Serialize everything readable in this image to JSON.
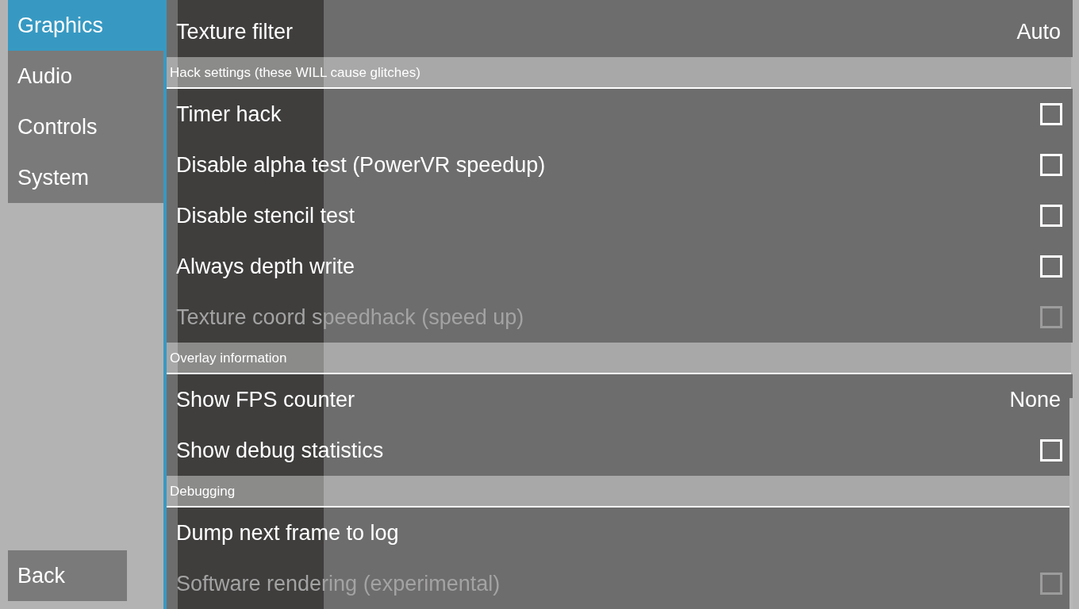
{
  "sidebar": {
    "tabs": [
      {
        "label": "Graphics",
        "selected": true
      },
      {
        "label": "Audio",
        "selected": false
      },
      {
        "label": "Controls",
        "selected": false
      },
      {
        "label": "System",
        "selected": false
      }
    ],
    "back_button": "Back"
  },
  "settings": [
    {
      "kind": "choice",
      "label": "Texture filter",
      "value": "Auto",
      "disabled": false
    },
    {
      "kind": "header",
      "label": "Hack settings (these WILL cause glitches)"
    },
    {
      "kind": "checkbox",
      "label": "Timer hack",
      "checked": false,
      "disabled": false
    },
    {
      "kind": "checkbox",
      "label": "Disable alpha test (PowerVR speedup)",
      "checked": false,
      "disabled": false
    },
    {
      "kind": "checkbox",
      "label": "Disable stencil test",
      "checked": false,
      "disabled": false
    },
    {
      "kind": "checkbox",
      "label": "Always depth write",
      "checked": false,
      "disabled": false
    },
    {
      "kind": "checkbox",
      "label": "Texture coord speedhack (speed up)",
      "checked": false,
      "disabled": true
    },
    {
      "kind": "header",
      "label": "Overlay information"
    },
    {
      "kind": "choice",
      "label": "Show FPS counter",
      "value": "None",
      "disabled": false
    },
    {
      "kind": "checkbox",
      "label": "Show debug statistics",
      "checked": false,
      "disabled": false
    },
    {
      "kind": "header",
      "label": "Debugging"
    },
    {
      "kind": "action",
      "label": "Dump next frame to log",
      "disabled": false
    },
    {
      "kind": "checkbox",
      "label": "Software rendering (experimental)",
      "checked": false,
      "disabled": true
    }
  ]
}
